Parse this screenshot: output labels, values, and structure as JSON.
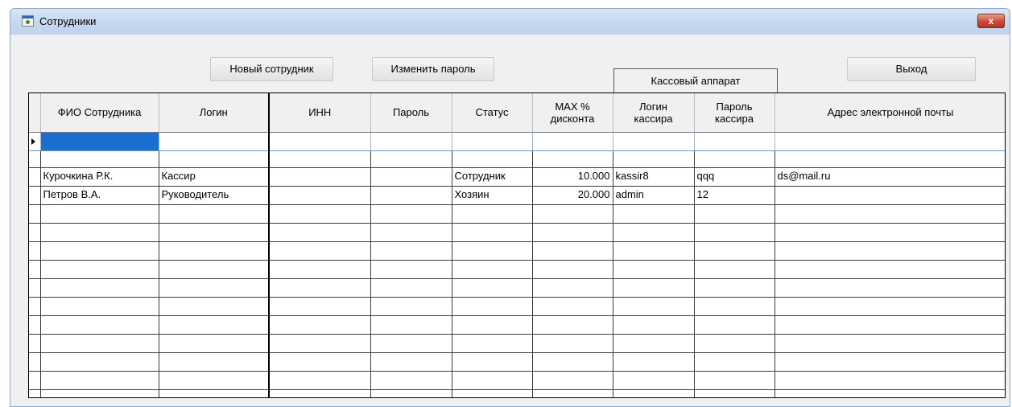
{
  "window": {
    "title": "Сотрудники",
    "close_label": "x"
  },
  "toolbar": {
    "new_employee": "Новый сотрудник",
    "change_password": "Изменить пароль",
    "cash_register": "Кассовый аппарат",
    "exit": "Выход"
  },
  "grid": {
    "columns": [
      "ФИО Сотрудника",
      "Логин",
      "ИНН",
      "Пароль",
      "Статус",
      "MAX %\nдисконта",
      "Логин\nкассира",
      "Пароль\nкассира",
      "Адрес электронной почты"
    ],
    "rows": [
      {
        "name": "Курочкина Р.К.",
        "login": "Кассир",
        "inn": "",
        "password": "",
        "status": "Сотрудник",
        "max_discount": "10.000",
        "cashier_login": "kassir8",
        "cashier_password": "qqq",
        "email": "ds@mail.ru"
      },
      {
        "name": "Петров В.А.",
        "login": "Руководитель",
        "inn": "",
        "password": "",
        "status": "Хозяин",
        "max_discount": "20.000",
        "cashier_login": "admin",
        "cashier_password": "12",
        "email": ""
      }
    ]
  }
}
